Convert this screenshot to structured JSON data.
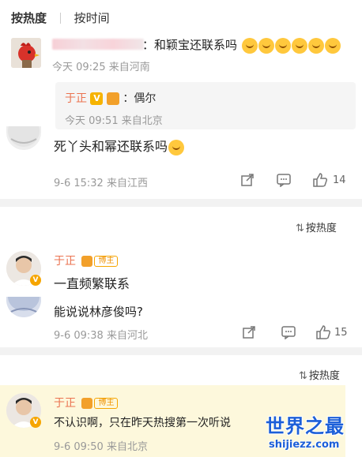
{
  "sort_tabs": {
    "active": "按热度",
    "other": "按时间"
  },
  "comment1": {
    "text_suffix": "：和颖宝还联系吗",
    "meta": "今天 09:25 来自河南"
  },
  "reply1": {
    "name": "于正",
    "badge_v": "V",
    "text": "：偶尔",
    "meta": "今天 09:51 来自北京"
  },
  "comment2": {
    "text": "死丫头和幂还联系吗",
    "meta": "9-6 15:32 来自江西",
    "like_count": "14"
  },
  "thread2": {
    "sort_label": "按热度",
    "op_name": "于正",
    "blogger_tag": "博主",
    "op_text": "一直频繁联系",
    "question": "能说说林彦俊吗?",
    "meta": "9-6 09:38 来自河北",
    "like_count": "15"
  },
  "thread3": {
    "sort_label": "按热度",
    "op_name": "于正",
    "blogger_tag": "博主",
    "op_text": "不认识啊，只在昨天热搜第一次听说",
    "meta": "9-6 09:50 来自北京"
  },
  "watermark": {
    "title": "世界之最",
    "url": "shijiezz.com"
  },
  "colors": {
    "name": "#eb7350",
    "meta": "#999999",
    "band": "#f2f2f2",
    "highlight": "#fdf8dc",
    "watermark": "#1c5fd8"
  }
}
